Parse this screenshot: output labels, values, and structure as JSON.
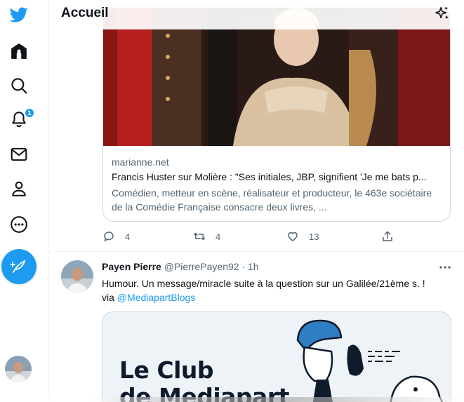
{
  "header": {
    "title": "Accueil"
  },
  "sidebar": {
    "items": [
      {
        "name": "twitter-logo",
        "icon": "twitter-bird-icon"
      },
      {
        "name": "home",
        "icon": "home-icon"
      },
      {
        "name": "explore",
        "icon": "search-icon"
      },
      {
        "name": "notifications",
        "icon": "bell-icon",
        "badge": "1"
      },
      {
        "name": "messages",
        "icon": "envelope-icon"
      },
      {
        "name": "profile",
        "icon": "person-icon"
      },
      {
        "name": "more",
        "icon": "more-circle-icon"
      }
    ],
    "compose_icon": "compose-feather-icon"
  },
  "tweet1": {
    "card": {
      "domain": "marianne.net",
      "title": "Francis Huster sur Molière : \"Ses initiales, JBP, signifient 'Je me bats p...",
      "description": "Comédien, metteur en scène, réalisateur et producteur, le 463e sociétaire de la Comédie Française consacre deux livres, ..."
    },
    "actions": {
      "replies": "4",
      "retweets": "4",
      "likes": "13"
    }
  },
  "tweet2": {
    "name": "Payen Pierre",
    "handle": "@PierrePayen92",
    "dot": "·",
    "time": "1h",
    "text": "Humour. Un message/miracle suite à la question sur un Galilée/21ème s. !",
    "via": "via ",
    "mention": "@MediapartBlogs",
    "card_title_line1": "Le Club",
    "card_title_line2": "de Mediapart"
  },
  "colors": {
    "accent": "#1d9bf0",
    "text": "#0f1419",
    "secondary": "#536471"
  }
}
